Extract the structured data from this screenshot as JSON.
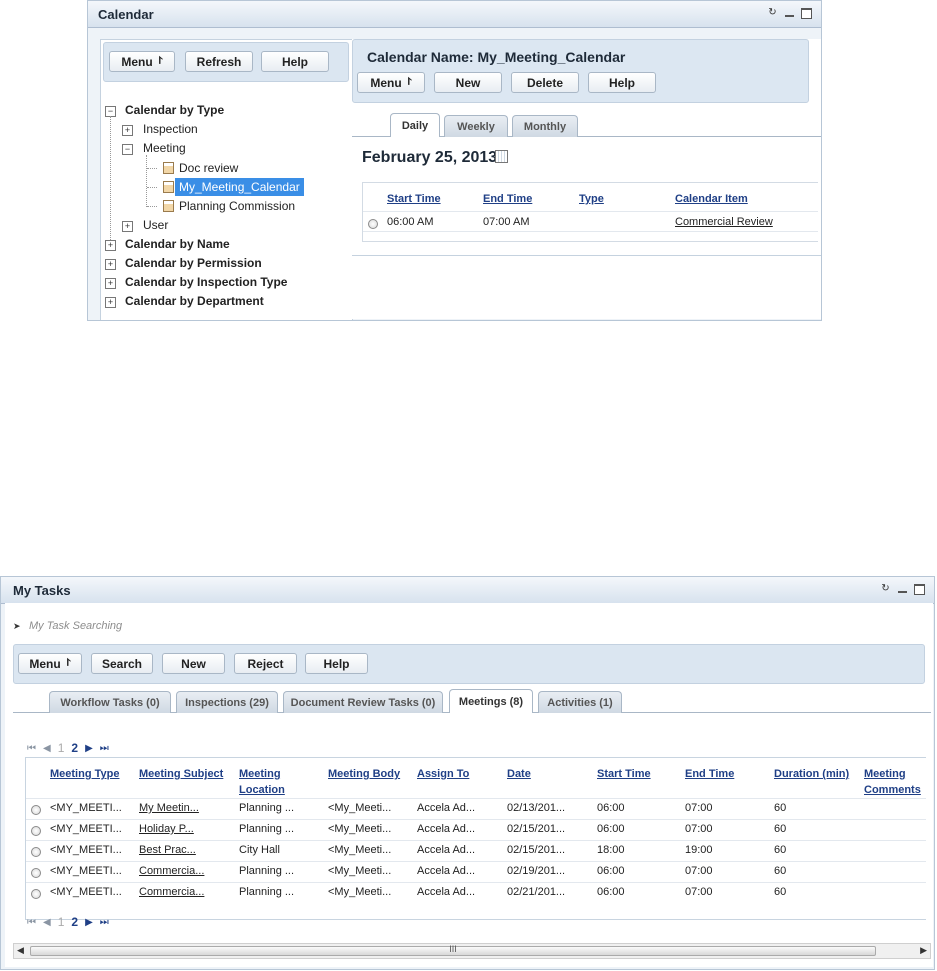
{
  "calendar": {
    "title": "Calendar",
    "left_toolbar": {
      "menu": "Menu",
      "refresh": "Refresh",
      "help": "Help"
    },
    "tree": {
      "by_type": "Calendar by Type",
      "inspection": "Inspection",
      "meeting": "Meeting",
      "doc_review": "Doc review",
      "my_meeting_calendar": "My_Meeting_Calendar",
      "planning_commission": "Planning Commission",
      "user": "User",
      "by_name": "Calendar by Name",
      "by_permission": "Calendar by Permission",
      "by_inspection_type": "Calendar by Inspection Type",
      "by_department": "Calendar by Department"
    },
    "header": {
      "calendar_name": "Calendar Name: My_Meeting_Calendar"
    },
    "right_toolbar": {
      "menu": "Menu",
      "new": "New",
      "delete": "Delete",
      "help": "Help"
    },
    "tabs": [
      "Daily",
      "Weekly",
      "Monthly"
    ],
    "active_tab": "Daily",
    "date": "February 25, 2013",
    "table": {
      "columns": [
        "Start Time",
        "End Time",
        "Type",
        "Calendar Item"
      ],
      "rows": [
        {
          "start": "06:00 AM",
          "end": "07:00 AM",
          "type": "",
          "item": "Commercial Review"
        }
      ]
    }
  },
  "tasks": {
    "title": "My Tasks",
    "search_label": "My Task Searching",
    "toolbar": {
      "menu": "Menu",
      "search": "Search",
      "new": "New",
      "reject": "Reject",
      "help": "Help"
    },
    "tabs": [
      "Workflow Tasks (0)",
      "Inspections (29)",
      "Document Review Tasks (0)",
      "Meetings (8)",
      "Activities (1)"
    ],
    "active_tab": "Meetings (8)",
    "pager": {
      "pages": [
        "1",
        "2"
      ],
      "current": "2"
    },
    "columns": {
      "meeting_type": "Meeting Type",
      "meeting_subject": "Meeting Subject",
      "meeting_location_1": "Meeting",
      "meeting_location_2": "Location",
      "meeting_body": "Meeting Body",
      "assign_to": "Assign To",
      "date": "Date",
      "start_time": "Start Time",
      "end_time": "End Time",
      "duration": "Duration (min)",
      "comments_1": "Meeting",
      "comments_2": "Comments"
    },
    "rows": [
      {
        "type": "<MY_MEETI...",
        "subject": "My Meetin...",
        "location": "Planning ...",
        "body": "<My_Meeti...",
        "assign": "Accela Ad...",
        "date": "02/13/201...",
        "start": "06:00",
        "end": "07:00",
        "duration": "60"
      },
      {
        "type": "<MY_MEETI...",
        "subject": "Holiday P...",
        "location": "Planning ...",
        "body": "<My_Meeti...",
        "assign": "Accela Ad...",
        "date": "02/15/201...",
        "start": "06:00",
        "end": "07:00",
        "duration": "60"
      },
      {
        "type": "<MY_MEETI...",
        "subject": "Best Prac...",
        "location": "City Hall",
        "body": "<My_Meeti...",
        "assign": "Accela Ad...",
        "date": "02/15/201...",
        "start": "18:00",
        "end": "19:00",
        "duration": "60"
      },
      {
        "type": "<MY_MEETI...",
        "subject": "Commercia...",
        "location": "Planning ...",
        "body": "<My_Meeti...",
        "assign": "Accela Ad...",
        "date": "02/19/201...",
        "start": "06:00",
        "end": "07:00",
        "duration": "60"
      },
      {
        "type": "<MY_MEETI...",
        "subject": "Commercia...",
        "location": "Planning ...",
        "body": "<My_Meeti...",
        "assign": "Accela Ad...",
        "date": "02/21/201...",
        "start": "06:00",
        "end": "07:00",
        "duration": "60"
      }
    ],
    "scroll_grip": "III"
  }
}
